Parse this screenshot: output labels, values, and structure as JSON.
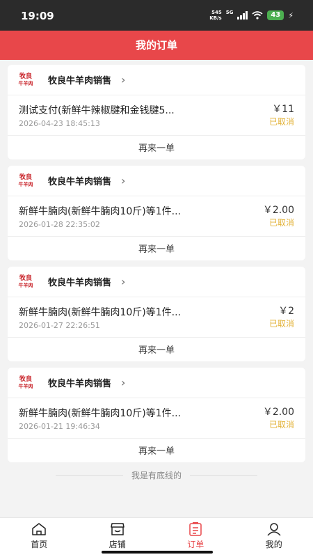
{
  "status_bar": {
    "time": "19:09",
    "net_speed_value": "545",
    "net_speed_unit": "KB/s",
    "network": "5G",
    "battery": "43"
  },
  "header": {
    "title": "我的订单"
  },
  "orders": [
    {
      "shop_logo_line1": "牧良",
      "shop_logo_line2": "牛羊肉",
      "shop_name": "牧良牛羊肉销售",
      "item": "测试支付(新鲜牛辣椒腱和金钱腱5...",
      "date": "2026-04-23 18:45:13",
      "price": "￥11",
      "status": "已取消",
      "reorder": "再来一单"
    },
    {
      "shop_logo_line1": "牧良",
      "shop_logo_line2": "牛羊肉",
      "shop_name": "牧良牛羊肉销售",
      "item": "新鲜牛腩肉(新鲜牛腩肉10斤)等1件...",
      "date": "2026-01-28 22:35:02",
      "price": "￥2.00",
      "status": "已取消",
      "reorder": "再来一单"
    },
    {
      "shop_logo_line1": "牧良",
      "shop_logo_line2": "牛羊肉",
      "shop_name": "牧良牛羊肉销售",
      "item": "新鲜牛腩肉(新鲜牛腩肉10斤)等1件...",
      "date": "2026-01-27 22:26:51",
      "price": "￥2",
      "status": "已取消",
      "reorder": "再来一单"
    },
    {
      "shop_logo_line1": "牧良",
      "shop_logo_line2": "牛羊肉",
      "shop_name": "牧良牛羊肉销售",
      "item": "新鲜牛腩肉(新鲜牛腩肉10斤)等1件...",
      "date": "2026-01-21 19:46:34",
      "price": "￥2.00",
      "status": "已取消",
      "reorder": "再来一单"
    }
  ],
  "footer_note": "我是有底线的",
  "tabs": [
    {
      "label": "首页",
      "icon": "home-icon"
    },
    {
      "label": "店铺",
      "icon": "store-icon"
    },
    {
      "label": "订单",
      "icon": "order-list-icon",
      "active": true
    },
    {
      "label": "我的",
      "icon": "profile-icon"
    }
  ],
  "colors": {
    "accent": "#e8474a",
    "status_cancelled": "#e3b33a",
    "logo_red": "#c9252b"
  }
}
